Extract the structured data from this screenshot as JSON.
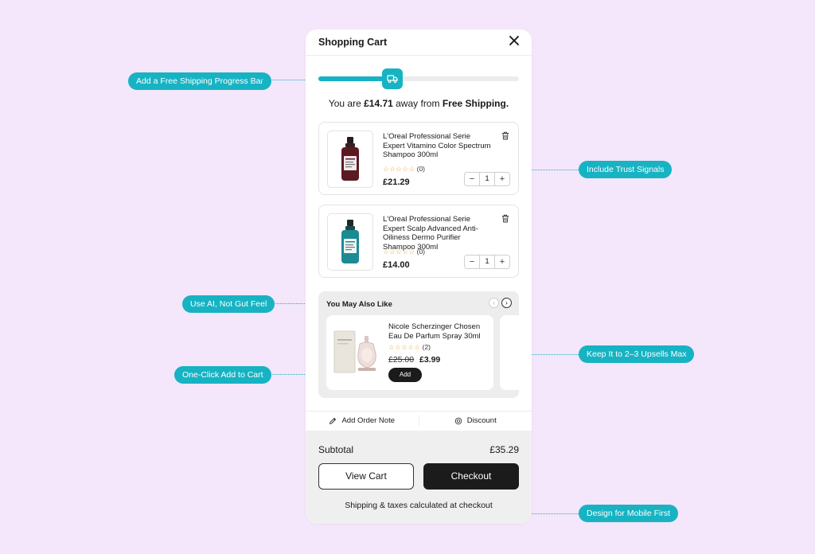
{
  "callouts": {
    "free_shipping": "Add a Free Shipping Progress Bar",
    "trust_signals": "Include Trust Signals",
    "use_ai": "Use AI, Not Gut Feel",
    "upsells_max": "Keep It to 2–3 Upsells Max",
    "one_click": "One-Click Add to Cart",
    "mobile_first": "Design for Mobile First"
  },
  "cart": {
    "title": "Shopping Cart",
    "close_icon": "close-icon",
    "progress_fraction": 0.37,
    "shipping_prefix": "You are ",
    "shipping_amount": "£14.71",
    "shipping_mid": " away from ",
    "shipping_target": "Free Shipping."
  },
  "items": [
    {
      "name": "L'Oreal Professional Serie Expert Vitamino Color Spectrum Shampoo 300ml",
      "stars": "☆☆☆☆☆",
      "rating_count": "(0)",
      "price": "£21.29",
      "qty": "1",
      "minus": "−",
      "plus": "+"
    },
    {
      "name": "L'Oreal Professional Serie Expert Scalp Advanced Anti-Oiliness Dermo Purifier Shampoo 300ml",
      "stars": "☆☆☆☆☆",
      "rating_count": "(0)",
      "price": "£14.00",
      "qty": "1",
      "minus": "−",
      "plus": "+"
    }
  ],
  "upsell": {
    "title": "You May Also Like",
    "prev": "‹",
    "next": "›",
    "product": {
      "name": "Nicole Scherzinger Chosen Eau De Parfum Spray 30ml",
      "stars": "☆☆☆☆☆",
      "rating_count": "(2)",
      "old_price": "£25.00",
      "new_price": "£3.99",
      "add_label": "Add"
    }
  },
  "actions": {
    "order_note": "Add Order Note",
    "discount": "Discount"
  },
  "footer": {
    "subtotal_label": "Subtotal",
    "subtotal_value": "£35.29",
    "view_cart": "View Cart",
    "checkout": "Checkout",
    "note": "Shipping & taxes calculated at checkout"
  },
  "colors": {
    "accent": "#17b3c3",
    "background": "#f4e6fb",
    "dark": "#1b1b1b"
  }
}
